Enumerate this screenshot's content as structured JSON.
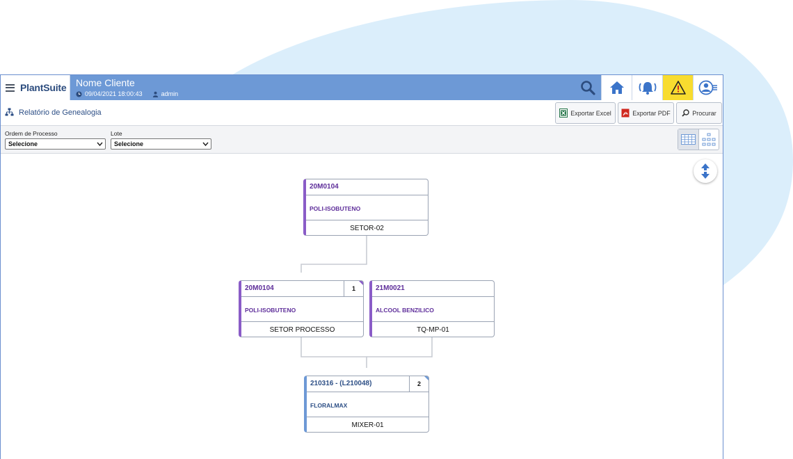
{
  "header": {
    "app_name": "PlantSuite",
    "client_name": "Nome Cliente",
    "datetime": "09/04/2021 18:00:43",
    "user": "admin",
    "icons": [
      "menu-icon",
      "search-icon",
      "home-icon",
      "alarm-icon",
      "warning-icon",
      "user-icon"
    ],
    "accent_color": "#6d99d6",
    "warning_color": "#f8dc2f"
  },
  "titlebar": {
    "title": "Relatório de Genealogia",
    "buttons": {
      "excel": "Exportar Excel",
      "pdf": "Exportar PDF",
      "search": "Procurar"
    }
  },
  "filters": {
    "ordem_label": "Ordem de Processo",
    "ordem_value": "Selecione",
    "lote_label": "Lote",
    "lote_value": "Selecione"
  },
  "genealogy": {
    "nodes": [
      {
        "id": "n1",
        "code": "20M0104",
        "material": "POLI-ISOBUTENO",
        "location": "SETOR-02",
        "count": "",
        "color": "purple"
      },
      {
        "id": "n2",
        "code": "20M0104",
        "material": "POLI-ISOBUTENO",
        "location": "SETOR PROCESSO",
        "count": "1",
        "color": "purple"
      },
      {
        "id": "n3",
        "code": "21M0021",
        "material": "ALCOOL BENZILICO",
        "location": "TQ-MP-01",
        "count": "",
        "color": "purple"
      },
      {
        "id": "n4",
        "code": "210316 - (L210048)",
        "material": "FLORALMAX",
        "location": "MIXER-01",
        "count": "2",
        "color": "blue"
      }
    ],
    "links": [
      [
        "n1",
        "n2"
      ],
      [
        "n2",
        "n4"
      ],
      [
        "n3",
        "n4"
      ]
    ]
  }
}
